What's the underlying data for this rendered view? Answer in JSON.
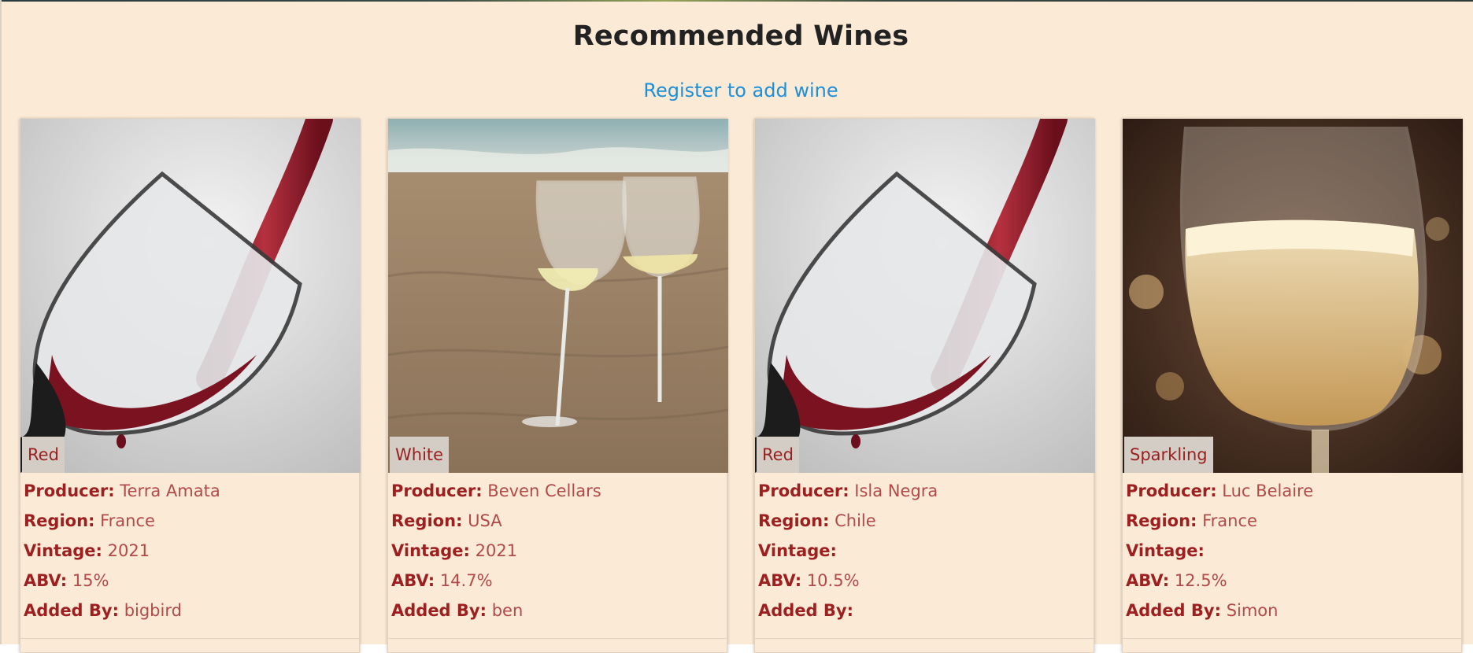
{
  "page": {
    "title": "Recommended Wines",
    "register_link": "Register to add wine"
  },
  "labels": {
    "producer": "Producer:",
    "region": "Region:",
    "vintage": "Vintage:",
    "abv": "ABV:",
    "added_by": "Added By:"
  },
  "wines": [
    {
      "type": "Red",
      "producer": "Terra Amata",
      "region": "France",
      "vintage": "2021",
      "abv": "15%",
      "added_by": "bigbird",
      "image": "red-wine-pour-image"
    },
    {
      "type": "White",
      "producer": "Beven Cellars",
      "region": "USA",
      "vintage": "2021",
      "abv": "14.7%",
      "added_by": "ben",
      "image": "white-wine-beach-image"
    },
    {
      "type": "Red",
      "producer": "Isla Negra",
      "region": "Chile",
      "vintage": "",
      "abv": "10.5%",
      "added_by": "",
      "image": "red-wine-pour-image"
    },
    {
      "type": "Sparkling",
      "producer": "Luc Belaire",
      "region": "France",
      "vintage": "",
      "abv": "12.5%",
      "added_by": "Simon",
      "image": "sparkling-wine-glass-image"
    }
  ],
  "colors": {
    "background": "#faead6",
    "label": "#9d1f1f",
    "link": "#1e8fd8"
  }
}
